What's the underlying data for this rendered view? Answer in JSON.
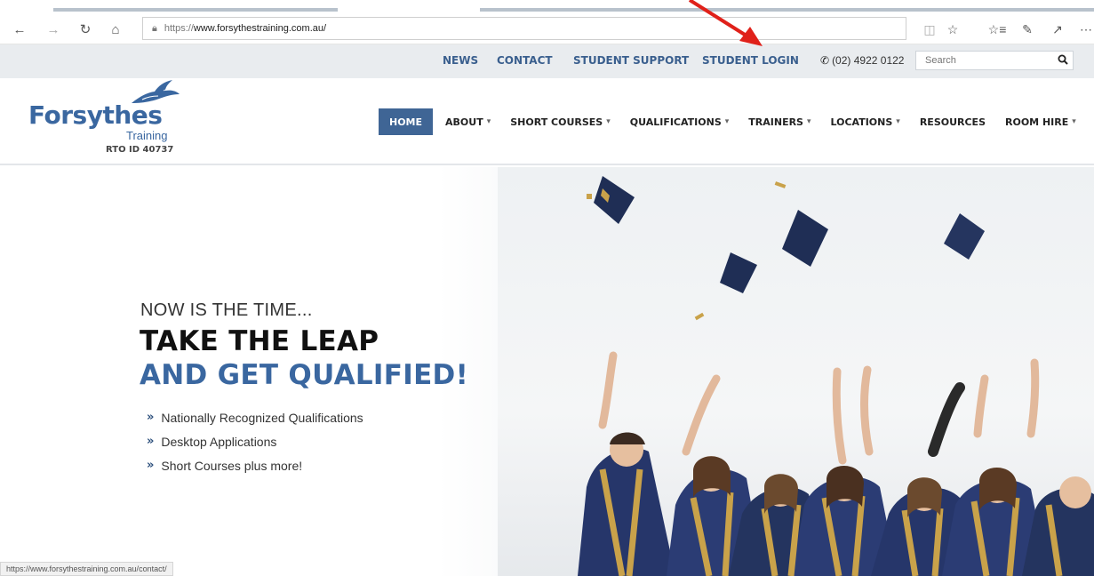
{
  "browser": {
    "url_protocol": "https://",
    "url_host": "www.forsythestraining.com.au/",
    "status_url": "https://www.forsythestraining.com.au/contact/"
  },
  "topbar": {
    "links": [
      "NEWS",
      "CONTACT",
      "STUDENT SUPPORT",
      "STUDENT LOGIN"
    ],
    "phone": "(02) 4922 0122",
    "search_placeholder": "Search"
  },
  "logo": {
    "name": "Forsythes",
    "sub": "Training",
    "rto": "RTO ID 40737"
  },
  "nav": {
    "items": [
      {
        "label": "HOME",
        "active": true,
        "dropdown": false
      },
      {
        "label": "ABOUT",
        "dropdown": true
      },
      {
        "label": "SHORT COURSES",
        "dropdown": true
      },
      {
        "label": "QUALIFICATIONS",
        "dropdown": true
      },
      {
        "label": "TRAINERS",
        "dropdown": true
      },
      {
        "label": "LOCATIONS",
        "dropdown": true
      },
      {
        "label": "RESOURCES",
        "dropdown": false
      },
      {
        "label": "ROOM HIRE",
        "dropdown": true
      }
    ]
  },
  "hero": {
    "eyebrow": "NOW IS THE TIME...",
    "headline1": "TAKE THE LEAP",
    "headline2": "AND GET QUALIFIED!",
    "bullets": [
      "Nationally Recognized Qualifications",
      "Desktop Applications",
      "Short Courses plus more!"
    ]
  },
  "colors": {
    "brand": "#3a67a0",
    "nav_active": "#3f6595",
    "annotation_arrow": "#e0211a"
  }
}
